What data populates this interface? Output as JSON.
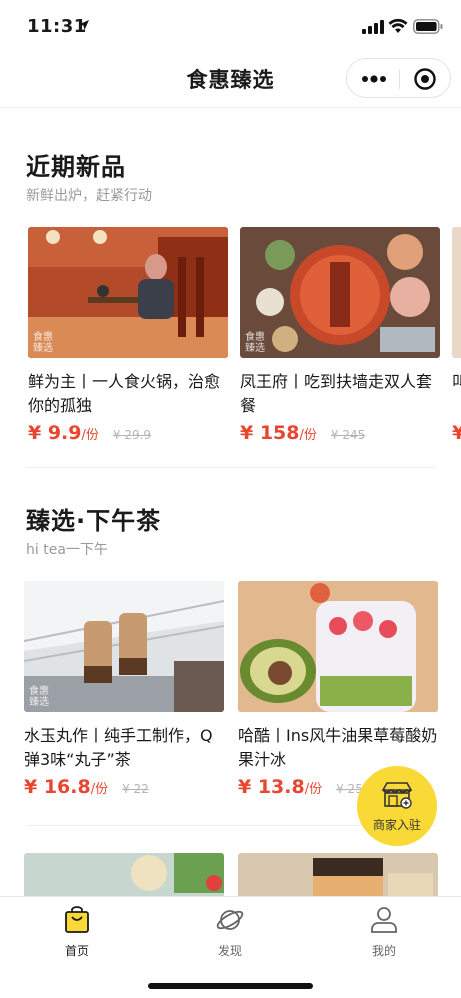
{
  "status_bar": {
    "time": "11:31"
  },
  "nav": {
    "title": "食惠臻选"
  },
  "sections": [
    {
      "title": "近期新品",
      "subtitle": "新鲜出炉，赶紧行动",
      "items": [
        {
          "name": "鲜为主丨一人食火锅，治愈你的孤独",
          "price": "¥ 9.9",
          "unit": "/份",
          "original": "¥ 29.9",
          "watermark": "食惠臻选"
        },
        {
          "name": "凤王府丨吃到扶墙走双人套餐",
          "price": "¥ 158",
          "unit": "/份",
          "original": "¥ 245",
          "watermark": "食惠臻选"
        },
        {
          "name": "叫 好",
          "price": "¥"
        }
      ]
    },
    {
      "title": "臻选·下午茶",
      "subtitle": "hi tea一下午",
      "items": [
        {
          "name": "水玉丸作丨纯手工制作，Q弹3味“丸子”茶",
          "price": "¥ 16.8",
          "unit": "/份",
          "original": "¥ 22",
          "watermark": "食惠臻选"
        },
        {
          "name": "哈酷丨Ins风牛油果草莓酸奶果汁冰",
          "price": "¥ 13.8",
          "unit": "/份",
          "original": "¥ 25"
        }
      ]
    }
  ],
  "float_button": {
    "label": "商家入驻"
  },
  "tabs": [
    {
      "label": "首页",
      "icon": "bag-icon",
      "active": true
    },
    {
      "label": "发现",
      "icon": "planet-icon",
      "active": false
    },
    {
      "label": "我的",
      "icon": "person-icon",
      "active": false
    }
  ],
  "colors": {
    "price": "#e9462f",
    "accent": "#f8d935",
    "subtitle": "#9a9a9a"
  }
}
